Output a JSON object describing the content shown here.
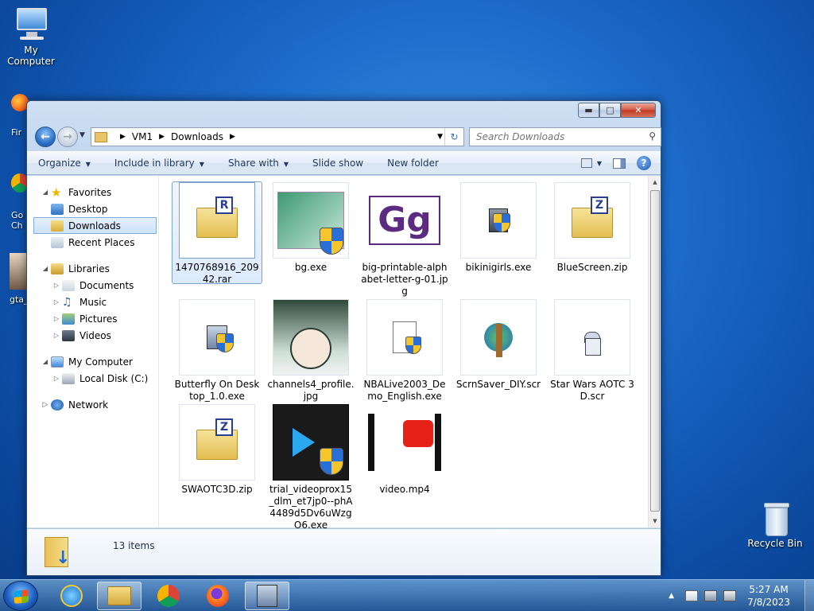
{
  "desktop": {
    "my_computer_label": "My Computer",
    "recycle_bin_label": "Recycle Bin",
    "partial_labels": [
      "Fir",
      "Go",
      "Ch",
      "gta_"
    ]
  },
  "window": {
    "address": {
      "segments": [
        "VM1",
        "Downloads"
      ]
    },
    "search_placeholder": "Search Downloads",
    "toolbar": {
      "organize": "Organize",
      "include_in_library": "Include in library",
      "share_with": "Share with",
      "slide_show": "Slide show",
      "new_folder": "New folder"
    },
    "nav": {
      "favorites": "Favorites",
      "desktop": "Desktop",
      "downloads": "Downloads",
      "recent_places": "Recent Places",
      "libraries": "Libraries",
      "documents": "Documents",
      "music": "Music",
      "pictures": "Pictures",
      "videos": "Videos",
      "my_computer": "My Computer",
      "local_disk": "Local Disk (C:)",
      "network": "Network"
    },
    "files": [
      {
        "name": "1470768916_20942.rar",
        "icon": "rar-archive-icon"
      },
      {
        "name": "bg.exe",
        "icon": "exe-shield-icon"
      },
      {
        "name": "big-printable-alphabet-letter-g-01.jpg",
        "icon": "image-thumbnail"
      },
      {
        "name": "bikinigirls.exe",
        "icon": "setup-exe-icon"
      },
      {
        "name": "BlueScreen.zip",
        "icon": "zip-folder-icon"
      },
      {
        "name": "Butterfly On Desktop_1.0.exe",
        "icon": "installer-icon"
      },
      {
        "name": "channels4_profile.jpg",
        "icon": "image-thumbnail"
      },
      {
        "name": "NBALive2003_Demo_English.exe",
        "icon": "exe-shield-icon"
      },
      {
        "name": "ScrnSaver_DIY.scr",
        "icon": "screensaver-icon"
      },
      {
        "name": "Star Wars AOTC 3D.scr",
        "icon": "r2d2-icon"
      },
      {
        "name": "SWAOTC3D.zip",
        "icon": "zip-folder-icon"
      },
      {
        "name": "trial_videoprox15_dlm_et7jp0--phA4489d5Dv6uWzgO6.exe",
        "icon": "videoproc-icon"
      },
      {
        "name": "video.mp4",
        "icon": "video-thumbnail"
      }
    ],
    "status": "13 items"
  },
  "taskbar": {
    "time": "5:27 AM",
    "date": "7/8/2023"
  },
  "colors": {
    "desktop_blue": "#1d6ccc",
    "selection": "#cde3f9",
    "window_frame": "#b9d1ec"
  }
}
